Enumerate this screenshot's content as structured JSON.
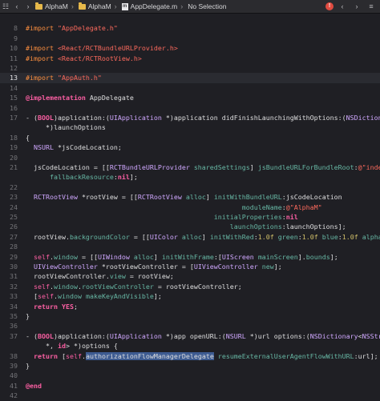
{
  "toolbar": {
    "crumbs": [
      {
        "icon": "folder-icon",
        "label": "AlphaM"
      },
      {
        "icon": "folder-icon",
        "label": "AlphaM"
      },
      {
        "icon": "objc-file-icon",
        "label": "AppDelegate.m"
      },
      {
        "icon": "none",
        "label": "No Selection"
      }
    ]
  },
  "editor": {
    "current_line": 13,
    "lines": [
      {
        "n": "",
        "tokens": []
      },
      {
        "n": "8",
        "tokens": [
          [
            "pre",
            "#import "
          ],
          [
            "str",
            "\"AppDelegate.h\""
          ]
        ]
      },
      {
        "n": "9",
        "tokens": []
      },
      {
        "n": "10",
        "tokens": [
          [
            "pre",
            "#import "
          ],
          [
            "str",
            "<React/RCTBundleURLProvider.h>"
          ]
        ]
      },
      {
        "n": "11",
        "tokens": [
          [
            "pre",
            "#import "
          ],
          [
            "str",
            "<React/RCTRootView.h>"
          ]
        ]
      },
      {
        "n": "12",
        "tokens": []
      },
      {
        "n": "13",
        "tokens": [
          [
            "pre",
            "#import "
          ],
          [
            "str",
            "\"AppAuth.h\""
          ]
        ]
      },
      {
        "n": "14",
        "tokens": []
      },
      {
        "n": "15",
        "tokens": [
          [
            "kw",
            "@implementation"
          ],
          [
            "plain",
            " AppDelegate"
          ]
        ]
      },
      {
        "n": "16",
        "tokens": []
      },
      {
        "n": "17",
        "tokens": [
          [
            "plain",
            "- ("
          ],
          [
            "kw",
            "BOOL"
          ],
          [
            "plain",
            ")application:("
          ],
          [
            "type",
            "UIApplication"
          ],
          [
            "plain",
            " *)application didFinishLaunchingWithOptions:("
          ],
          [
            "type",
            "NSDictionary"
          ]
        ]
      },
      {
        "n": "",
        "tokens": [
          [
            "plain",
            "     *)launchOptions"
          ]
        ]
      },
      {
        "n": "18",
        "tokens": [
          [
            "plain",
            "{"
          ]
        ]
      },
      {
        "n": "19",
        "tokens": [
          [
            "plain",
            "  "
          ],
          [
            "type",
            "NSURL"
          ],
          [
            "plain",
            " *jsCodeLocation;"
          ]
        ]
      },
      {
        "n": "20",
        "tokens": []
      },
      {
        "n": "21",
        "tokens": [
          [
            "plain",
            "  jsCodeLocation = [["
          ],
          [
            "type",
            "RCTBundleURLProvider"
          ],
          [
            "plain",
            " "
          ],
          [
            "meth",
            "sharedSettings"
          ],
          [
            "plain",
            "] "
          ],
          [
            "meth",
            "jsBundleURLForBundleRoot"
          ],
          [
            "plain",
            ":"
          ],
          [
            "str",
            "@\"index\""
          ]
        ]
      },
      {
        "n": "",
        "tokens": [
          [
            "plain",
            "      "
          ],
          [
            "meth",
            "fallbackResource"
          ],
          [
            "plain",
            ":"
          ],
          [
            "kw",
            "nil"
          ],
          [
            "plain",
            "];"
          ]
        ]
      },
      {
        "n": "22",
        "tokens": []
      },
      {
        "n": "23",
        "tokens": [
          [
            "plain",
            "  "
          ],
          [
            "type",
            "RCTRootView"
          ],
          [
            "plain",
            " *rootView = [["
          ],
          [
            "type",
            "RCTRootView"
          ],
          [
            "plain",
            " "
          ],
          [
            "meth",
            "alloc"
          ],
          [
            "plain",
            "] "
          ],
          [
            "meth",
            "initWithBundleURL"
          ],
          [
            "plain",
            ":jsCodeLocation"
          ]
        ]
      },
      {
        "n": "24",
        "tokens": [
          [
            "plain",
            "                                                      "
          ],
          [
            "meth",
            "moduleName"
          ],
          [
            "plain",
            ":"
          ],
          [
            "str",
            "@\"AlphaM\""
          ]
        ]
      },
      {
        "n": "25",
        "tokens": [
          [
            "plain",
            "                                               "
          ],
          [
            "meth",
            "initialProperties"
          ],
          [
            "plain",
            ":"
          ],
          [
            "kw",
            "nil"
          ]
        ]
      },
      {
        "n": "26",
        "tokens": [
          [
            "plain",
            "                                                   "
          ],
          [
            "meth",
            "launchOptions"
          ],
          [
            "plain",
            ":launchOptions];"
          ]
        ]
      },
      {
        "n": "27",
        "tokens": [
          [
            "plain",
            "  rootView."
          ],
          [
            "meth",
            "backgroundColor"
          ],
          [
            "plain",
            " = [["
          ],
          [
            "type",
            "UIColor"
          ],
          [
            "plain",
            " "
          ],
          [
            "meth",
            "alloc"
          ],
          [
            "plain",
            "] "
          ],
          [
            "meth",
            "initWithRed"
          ],
          [
            "plain",
            ":"
          ],
          [
            "num",
            "1.0f"
          ],
          [
            "plain",
            " "
          ],
          [
            "meth",
            "green"
          ],
          [
            "plain",
            ":"
          ],
          [
            "num",
            "1.0f"
          ],
          [
            "plain",
            " "
          ],
          [
            "meth",
            "blue"
          ],
          [
            "plain",
            ":"
          ],
          [
            "num",
            "1.0f"
          ],
          [
            "plain",
            " "
          ],
          [
            "meth",
            "alpha"
          ],
          [
            "plain",
            ":"
          ],
          [
            "num",
            "1"
          ],
          [
            "plain",
            "];"
          ]
        ]
      },
      {
        "n": "28",
        "tokens": []
      },
      {
        "n": "29",
        "tokens": [
          [
            "plain",
            "  "
          ],
          [
            "self",
            "self"
          ],
          [
            "plain",
            "."
          ],
          [
            "meth",
            "window"
          ],
          [
            "plain",
            " = [["
          ],
          [
            "type",
            "UIWindow"
          ],
          [
            "plain",
            " "
          ],
          [
            "meth",
            "alloc"
          ],
          [
            "plain",
            "] "
          ],
          [
            "meth",
            "initWithFrame"
          ],
          [
            "plain",
            ":["
          ],
          [
            "type",
            "UIScreen"
          ],
          [
            "plain",
            " "
          ],
          [
            "meth",
            "mainScreen"
          ],
          [
            "plain",
            "]."
          ],
          [
            "meth",
            "bounds"
          ],
          [
            "plain",
            "];"
          ]
        ]
      },
      {
        "n": "30",
        "tokens": [
          [
            "plain",
            "  "
          ],
          [
            "type",
            "UIViewController"
          ],
          [
            "plain",
            " *rootViewController = ["
          ],
          [
            "type",
            "UIViewController"
          ],
          [
            "plain",
            " "
          ],
          [
            "meth",
            "new"
          ],
          [
            "plain",
            "];"
          ]
        ]
      },
      {
        "n": "31",
        "tokens": [
          [
            "plain",
            "  rootViewController."
          ],
          [
            "meth",
            "view"
          ],
          [
            "plain",
            " = rootView;"
          ]
        ]
      },
      {
        "n": "32",
        "tokens": [
          [
            "plain",
            "  "
          ],
          [
            "self",
            "self"
          ],
          [
            "plain",
            "."
          ],
          [
            "meth",
            "window"
          ],
          [
            "plain",
            "."
          ],
          [
            "meth",
            "rootViewController"
          ],
          [
            "plain",
            " = rootViewController;"
          ]
        ]
      },
      {
        "n": "33",
        "tokens": [
          [
            "plain",
            "  ["
          ],
          [
            "self",
            "self"
          ],
          [
            "plain",
            "."
          ],
          [
            "meth",
            "window"
          ],
          [
            "plain",
            " "
          ],
          [
            "meth",
            "makeKeyAndVisible"
          ],
          [
            "plain",
            "];"
          ]
        ]
      },
      {
        "n": "34",
        "tokens": [
          [
            "plain",
            "  "
          ],
          [
            "kw",
            "return"
          ],
          [
            "plain",
            " "
          ],
          [
            "kw",
            "YES"
          ],
          [
            "plain",
            ";"
          ]
        ]
      },
      {
        "n": "35",
        "tokens": [
          [
            "plain",
            "}"
          ]
        ]
      },
      {
        "n": "36",
        "tokens": []
      },
      {
        "n": "37",
        "tokens": [
          [
            "plain",
            "- ("
          ],
          [
            "kw",
            "BOOL"
          ],
          [
            "plain",
            ")application:("
          ],
          [
            "type",
            "UIApplication"
          ],
          [
            "plain",
            " *)app openURL:("
          ],
          [
            "type",
            "NSURL"
          ],
          [
            "plain",
            " *)url options:("
          ],
          [
            "type",
            "NSDictionary"
          ],
          [
            "plain",
            "<"
          ],
          [
            "type",
            "NSString"
          ]
        ]
      },
      {
        "n": "",
        "tokens": [
          [
            "plain",
            "     *, "
          ],
          [
            "kw",
            "id"
          ],
          [
            "plain",
            "> *)options {"
          ]
        ]
      },
      {
        "n": "38",
        "tokens": [
          [
            "plain",
            "  "
          ],
          [
            "kw",
            "return"
          ],
          [
            "plain",
            " ["
          ],
          [
            "self",
            "self"
          ],
          [
            "plain",
            "."
          ],
          [
            "sel",
            "authorizationFlowManagerDelegate"
          ],
          [
            "plain",
            " "
          ],
          [
            "meth",
            "resumeExternalUserAgentFlowWithURL"
          ],
          [
            "plain",
            ":url];"
          ]
        ]
      },
      {
        "n": "39",
        "tokens": [
          [
            "plain",
            "}"
          ]
        ]
      },
      {
        "n": "40",
        "tokens": []
      },
      {
        "n": "41",
        "tokens": [
          [
            "kw",
            "@end"
          ]
        ]
      },
      {
        "n": "42",
        "tokens": []
      }
    ]
  }
}
